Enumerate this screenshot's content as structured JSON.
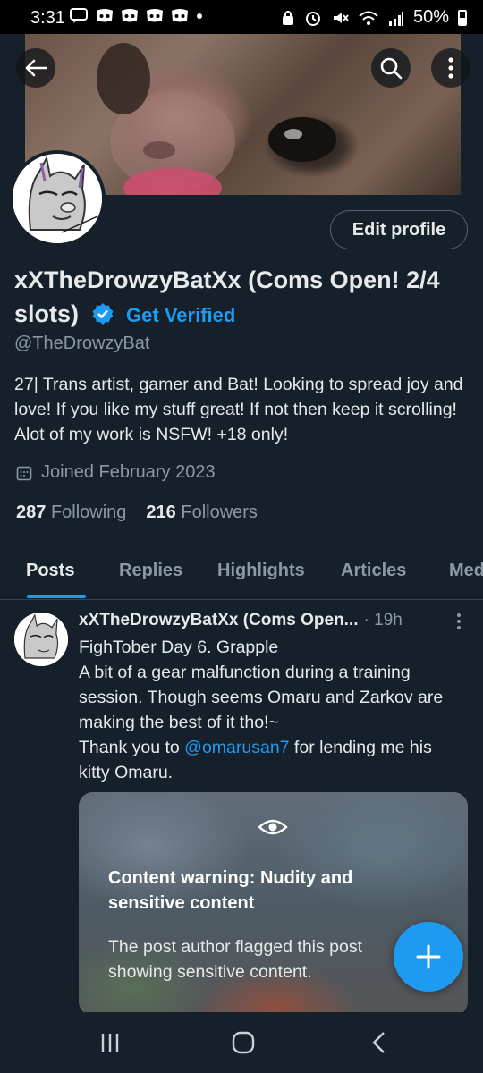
{
  "status_bar": {
    "time": "3:31",
    "battery": "50%"
  },
  "profile": {
    "display_name": "xXTheDrowzyBatXx (Coms Open! 2/4 slots)",
    "get_verified": "Get Verified",
    "handle": "@TheDrowzyBat",
    "bio": "27| Trans artist, gamer and Bat! Looking to spread joy and love! If you like my stuff great! If not then keep it scrolling! Alot of my work is NSFW! +18 only!",
    "joined": "Joined February 2023",
    "following_count": "287",
    "following_label": "Following",
    "followers_count": "216",
    "followers_label": "Followers",
    "edit_profile": "Edit profile"
  },
  "tabs": [
    {
      "label": "Posts",
      "active": true
    },
    {
      "label": "Replies"
    },
    {
      "label": "Highlights"
    },
    {
      "label": "Articles"
    },
    {
      "label": "Med"
    }
  ],
  "post": {
    "author": "xXTheDrowzyBatXx (Coms Open...",
    "time": "· 19h",
    "line1": "FighTober Day 6. Grapple",
    "line2": "A bit of a gear malfunction during a training session. Though seems Omaru and Zarkov are making the best of it tho!~",
    "thanks_prefix": "Thank you to ",
    "mention": "@omarusan7",
    "thanks_suffix": " for lending me his kitty Omaru.",
    "content_warning_title": "Content warning: Nudity and sensitive content",
    "content_warning_body": "The post author flagged this post showing sensitive content."
  },
  "colors": {
    "background": "#15202b",
    "accent": "#1d9bf0",
    "secondary_text": "#8b98a5"
  },
  "icons": [
    "back-arrow-icon",
    "search-icon",
    "more-vertical-icon",
    "verified-badge-icon",
    "calendar-icon",
    "eye-icon",
    "plus-icon",
    "recent-apps-icon",
    "home-icon",
    "back-icon"
  ]
}
